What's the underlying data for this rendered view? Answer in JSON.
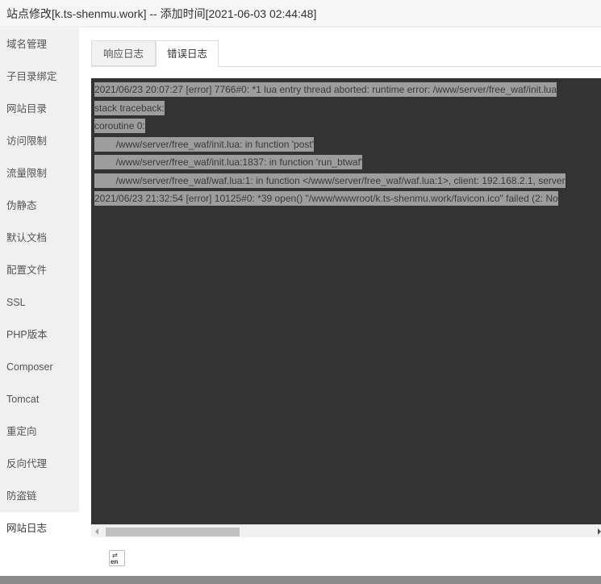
{
  "window": {
    "title": "站点修改[k.ts-shenmu.work] -- 添加时间[2021-06-03 02:44:48]"
  },
  "sidebar": {
    "items": [
      {
        "label": "域名管理"
      },
      {
        "label": "子目录绑定"
      },
      {
        "label": "网站目录"
      },
      {
        "label": "访问限制"
      },
      {
        "label": "流量限制"
      },
      {
        "label": "伪静态"
      },
      {
        "label": "默认文档"
      },
      {
        "label": "配置文件"
      },
      {
        "label": "SSL"
      },
      {
        "label": "PHP版本"
      },
      {
        "label": "Composer"
      },
      {
        "label": "Tomcat"
      },
      {
        "label": "重定向"
      },
      {
        "label": "反向代理"
      },
      {
        "label": "防盗链"
      },
      {
        "label": "网站日志",
        "active": true
      }
    ]
  },
  "tabs": [
    {
      "label": "响应日志",
      "active": false
    },
    {
      "label": "错误日志",
      "active": true
    }
  ],
  "log": {
    "lines": [
      "2021/06/23 20:07:27 [error] 7766#0: *1 lua entry thread aborted: runtime error: /www/server/free_waf/init.lua",
      "stack traceback:",
      "coroutine 0:",
      "        /www/server/free_waf/init.lua: in function 'post'",
      "        /www/server/free_waf/init.lua:1837: in function 'run_btwaf'",
      "        /www/server/free_waf/waf.lua:1: in function </www/server/free_waf/waf.lua:1>, client: 192.168.2.1, server",
      "2021/06/23 21:32:54 [error] 10125#0: *39 open() \"/www/wwwroot/k.ts-shenmu.work/favicon.ico\" failed (2: No"
    ]
  },
  "toolbar": {
    "encoding_icon": "encoding-switch-icon",
    "encoding_text": "en"
  },
  "colors": {
    "log_background": "#333333",
    "selection": "#9d9d9d",
    "sidebar_background": "#f0f0f0"
  }
}
